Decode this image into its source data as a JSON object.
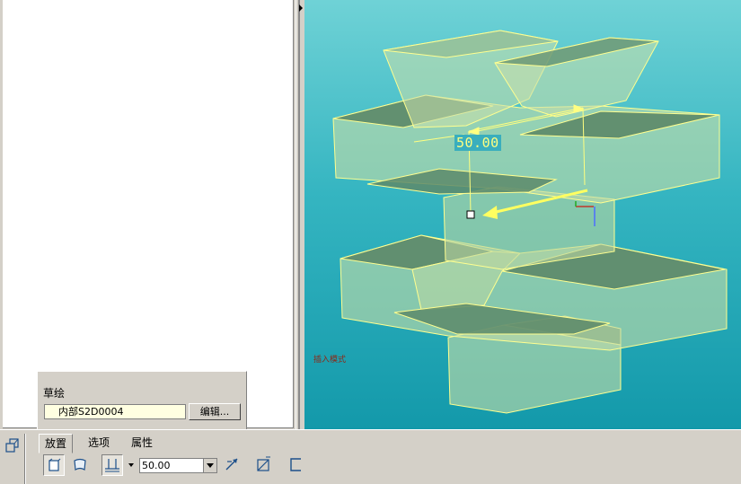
{
  "viewport": {
    "dimension_value": "50.00",
    "status_text": "插入模式"
  },
  "sketch_panel": {
    "title": "草绘",
    "sketch_name": "内部S2D0004",
    "edit_label": "编辑..."
  },
  "dashboard": {
    "tabs": [
      {
        "label": "放置"
      },
      {
        "label": "选项"
      },
      {
        "label": "属性"
      }
    ],
    "depth_value": "50.00",
    "icons": [
      "solid-icon",
      "surface-icon",
      "depth-blind-icon",
      "flip-direction-icon",
      "remove-material-icon",
      "thicken-icon"
    ]
  },
  "colors": {
    "viewport_top": "#6fd2d6",
    "viewport_bottom": "#1399aa",
    "model_fill": "#b8d6a0",
    "model_edge": "#ffff80",
    "dimension": "#ffff80"
  }
}
